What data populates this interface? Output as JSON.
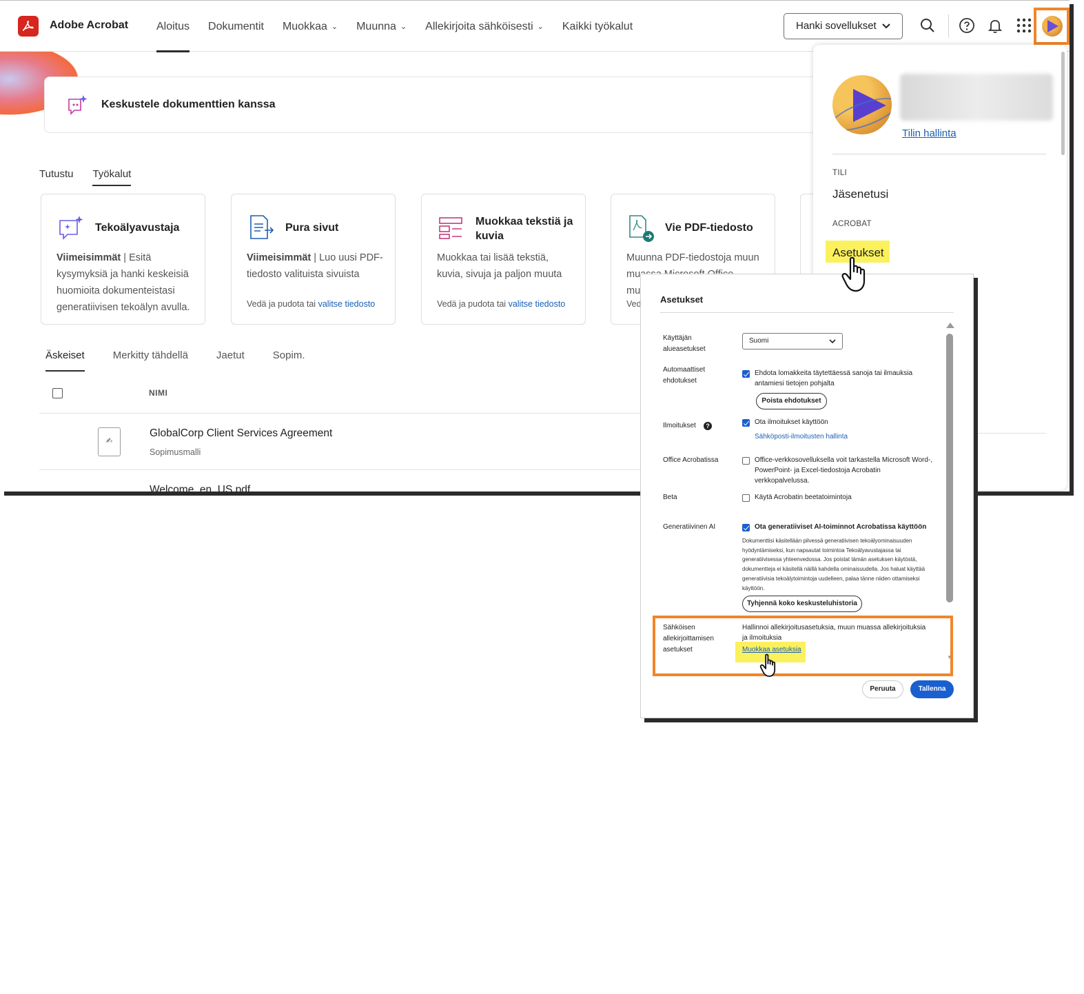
{
  "header": {
    "brand": "Adobe Acrobat",
    "nav": [
      {
        "label": "Aloitus",
        "active": true,
        "dropdown": false
      },
      {
        "label": "Dokumentit",
        "active": false,
        "dropdown": false
      },
      {
        "label": "Muokkaa",
        "active": false,
        "dropdown": true
      },
      {
        "label": "Muunna",
        "active": false,
        "dropdown": true
      },
      {
        "label": "Allekirjoita sähköisesti",
        "active": false,
        "dropdown": true
      },
      {
        "label": "Kaikki työkalut",
        "active": false,
        "dropdown": false
      }
    ],
    "get_apps": "Hanki sovellukset"
  },
  "chat_banner": {
    "label": "Keskustele dokumenttien kanssa"
  },
  "tabs_top": [
    {
      "label": "Tutustu"
    },
    {
      "label": "Työkalut"
    }
  ],
  "tools": [
    {
      "title": "Tekoälyavustaja",
      "recent": "Viimeisimmät",
      "desc": "Esitä kysymyksiä ja hanki keskeisiä huomioita dokumenteistasi generatiivisen tekoälyn avulla.",
      "drop": "",
      "pick": ""
    },
    {
      "title": "Pura sivut",
      "recent": "Viimeisimmät",
      "desc": "Luo uusi PDF-tiedosto valituista sivuista",
      "drop": "Vedä ja pudota tai",
      "pick": "valitse tiedosto"
    },
    {
      "title": "Muokkaa tekstiä ja kuvia",
      "recent": "",
      "desc": "Muokkaa tai lisää tekstiä, kuvia, sivuja ja paljon muuta",
      "drop": "Vedä ja pudota tai",
      "pick": "valitse tiedosto"
    },
    {
      "title": "Vie PDF-tiedosto",
      "recent": "",
      "desc": "Muunna PDF-tiedostoja muun muassa Microsoft Office-muotoon",
      "drop": "Ved",
      "pick": ""
    }
  ],
  "tabs_files": [
    {
      "label": "Äskeiset"
    },
    {
      "label": "Merkitty tähdellä"
    },
    {
      "label": "Jaetut"
    },
    {
      "label": "Sopim."
    }
  ],
  "files": {
    "column_name": "NIMI",
    "rows": [
      {
        "name": "GlobalCorp Client Services Agreement",
        "sub": "Sopimusmalli"
      },
      {
        "name": "Welcome_en_US.pdf",
        "sub": ""
      }
    ]
  },
  "account_menu": {
    "manage_link": "Tilin hallinta",
    "section_account": "TILI",
    "membership": "Jäsenetusi",
    "section_acrobat": "ACROBAT",
    "settings": "Asetukset"
  },
  "settings_dialog": {
    "title": "Asetukset",
    "locale": {
      "label": "Käyttäjän alueasetukset",
      "value": "Suomi"
    },
    "auto": {
      "label": "Automaattiset ehdotukset",
      "checked": true,
      "text": "Ehdota lomakkeita täytettäessä sanoja tai ilmauksia antamiesi tietojen pohjalta",
      "button": "Poista ehdotukset"
    },
    "notifications": {
      "label": "Ilmoitukset",
      "checked": true,
      "text": "Ota ilmoitukset käyttöön",
      "link": "Sähköposti-ilmoitusten hallinta"
    },
    "office": {
      "label": "Office Acrobatissa",
      "checked": false,
      "text": "Office-verkkosovelluksella voit tarkastella Microsoft Word-, PowerPoint- ja Excel-tiedostoja Acrobatin verkkopalvelussa."
    },
    "beta": {
      "label": "Beta",
      "checked": false,
      "text": "Käytä Acrobatin beetatoimintoja"
    },
    "genai": {
      "label": "Generatiivinen AI",
      "checked": true,
      "text": "Ota generatiiviset AI-toiminnot Acrobatissa käyttöön",
      "desc": "Dokumenttisi käsitellään pilvessä generatiivisen tekoälyominaisuuden hyödyntämiseksi, kun napsautat toimintoa Tekoälyavustajassa tai generatiivisessa yhteenvedossa. Jos poistat tämän asetuksen käytöstä, dokumentteja ei käsitellä näillä kahdella ominaisuudella. Jos haluat käyttää generatiivisia tekoälytoimintoja uudelleen, palaa tänne niiden ottamiseksi käyttöön.",
      "button": "Tyhjennä koko keskusteluhistoria"
    },
    "esign": {
      "label": "Sähköisen allekirjoittamisen asetukset",
      "text": "Hallinnoi allekirjoitusasetuksia, muun muassa allekirjoituksia ja ilmoituksia",
      "link": "Muokkaa asetuksia"
    },
    "cancel": "Peruuta",
    "save": "Tallenna"
  },
  "colors": {
    "accent": "#1a5fd0",
    "highlight_box": "#f0862a",
    "highlight_marker": "#fbf15d",
    "brand_red": "#d7251f"
  },
  "icons": [
    "acrobat-logo-icon",
    "search-icon",
    "help-icon",
    "bell-icon",
    "apps-grid-icon",
    "hand-cursor-icon",
    "chevron-down-icon",
    "info-icon"
  ]
}
